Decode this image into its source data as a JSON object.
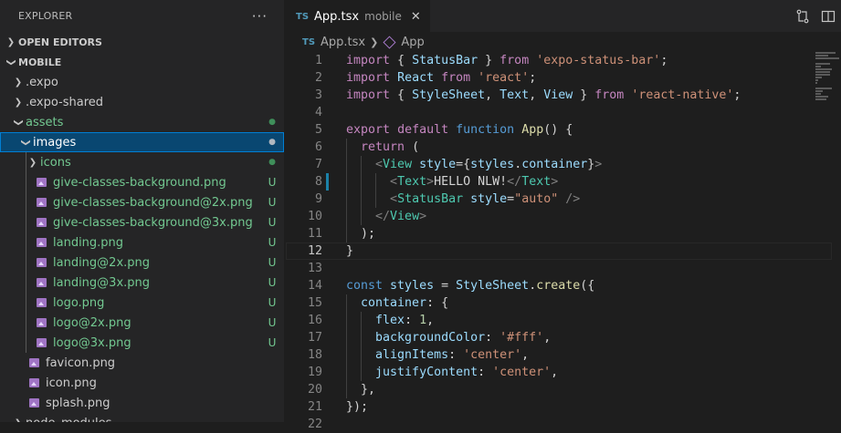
{
  "sidebar": {
    "title": "EXPLORER",
    "more": "···",
    "open_editors": "OPEN EDITORS",
    "project": "MOBILE",
    "items": [
      {
        "label": ".expo",
        "badge": "",
        "color": "#cccccc"
      },
      {
        "label": ".expo-shared",
        "badge": "",
        "color": "#cccccc"
      },
      {
        "label": "assets",
        "badge": "●",
        "color": "#73c991"
      },
      {
        "label": "images",
        "badge": "●",
        "color": "#ffffff"
      },
      {
        "label": "icons",
        "badge": "●",
        "color": "#73c991"
      },
      {
        "label": "give-classes-background.png",
        "badge": "U",
        "color": "#73c991"
      },
      {
        "label": "give-classes-background@2x.png",
        "badge": "U",
        "color": "#73c991"
      },
      {
        "label": "give-classes-background@3x.png",
        "badge": "U",
        "color": "#73c991"
      },
      {
        "label": "landing.png",
        "badge": "U",
        "color": "#73c991"
      },
      {
        "label": "landing@2x.png",
        "badge": "U",
        "color": "#73c991"
      },
      {
        "label": "landing@3x.png",
        "badge": "U",
        "color": "#73c991"
      },
      {
        "label": "logo.png",
        "badge": "U",
        "color": "#73c991"
      },
      {
        "label": "logo@2x.png",
        "badge": "U",
        "color": "#73c991"
      },
      {
        "label": "logo@3x.png",
        "badge": "U",
        "color": "#73c991"
      },
      {
        "label": "favicon.png",
        "badge": "",
        "color": "#cccccc"
      },
      {
        "label": "icon.png",
        "badge": "",
        "color": "#cccccc"
      },
      {
        "label": "splash.png",
        "badge": "",
        "color": "#cccccc"
      },
      {
        "label": "node_modules",
        "badge": "",
        "color": "#cccccc"
      }
    ]
  },
  "editor": {
    "tab": {
      "lang": "TS",
      "name": "App.tsx",
      "desc": "mobile",
      "close": "✕"
    },
    "breadcrumb": {
      "file": "App.tsx",
      "symbol": "App"
    },
    "current_line": 12,
    "modified_line": 8,
    "lines": [
      {
        "n": "1",
        "text": "import { StatusBar } from 'expo-status-bar';"
      },
      {
        "n": "2",
        "text": "import React from 'react';"
      },
      {
        "n": "3",
        "text": "import { StyleSheet, Text, View } from 'react-native';"
      },
      {
        "n": "4",
        "text": ""
      },
      {
        "n": "5",
        "text": "export default function App() {"
      },
      {
        "n": "6",
        "text": "  return ("
      },
      {
        "n": "7",
        "text": "    <View style={styles.container}>"
      },
      {
        "n": "8",
        "text": "      <Text>HELLO NLW!</Text>"
      },
      {
        "n": "9",
        "text": "      <StatusBar style=\"auto\" />"
      },
      {
        "n": "10",
        "text": "    </View>"
      },
      {
        "n": "11",
        "text": "  );"
      },
      {
        "n": "12",
        "text": "}"
      },
      {
        "n": "13",
        "text": ""
      },
      {
        "n": "14",
        "text": "const styles = StyleSheet.create({"
      },
      {
        "n": "15",
        "text": "  container: {"
      },
      {
        "n": "16",
        "text": "    flex: 1,"
      },
      {
        "n": "17",
        "text": "    backgroundColor: '#fff',"
      },
      {
        "n": "18",
        "text": "    alignItems: 'center',"
      },
      {
        "n": "19",
        "text": "    justifyContent: 'center',"
      },
      {
        "n": "20",
        "text": "  },"
      },
      {
        "n": "21",
        "text": "});"
      },
      {
        "n": "22",
        "text": ""
      }
    ]
  },
  "colors": {
    "accent": "#007fd4",
    "selection": "#094771",
    "untracked": "#73c991"
  },
  "icons": {
    "split": "split-editor-icon",
    "more": "more-actions-icon",
    "compare": "open-changes-icon"
  }
}
